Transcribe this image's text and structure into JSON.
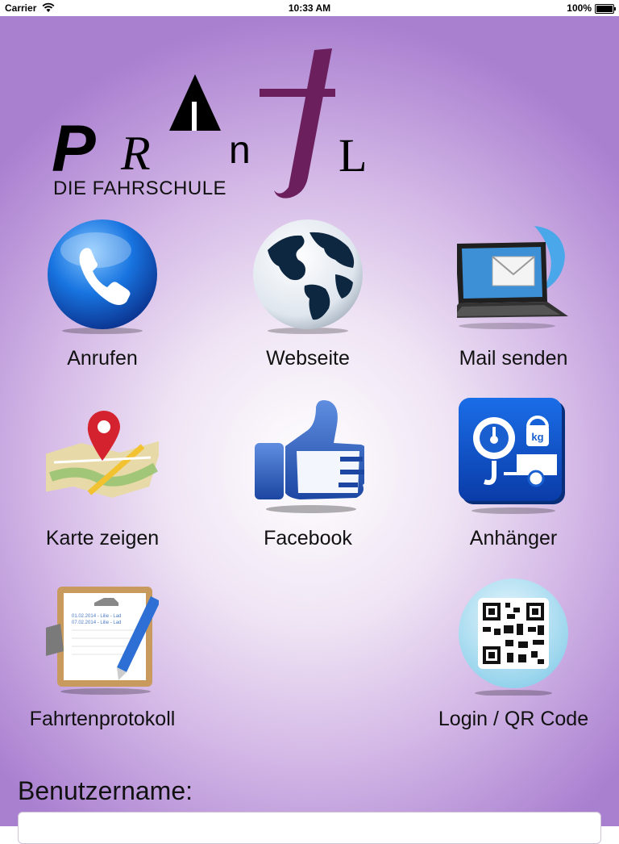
{
  "statusbar": {
    "carrier": "Carrier",
    "time": "10:33 AM",
    "battery": "100%"
  },
  "logo": {
    "letters": [
      "P",
      "R",
      "A",
      "n",
      "t",
      "L"
    ],
    "tagline": "DIE FAHRSCHULE",
    "accent_color": "#6b1f5c"
  },
  "tiles": [
    {
      "label": "Anrufen",
      "icon": "phone-icon"
    },
    {
      "label": "Webseite",
      "icon": "globe-icon"
    },
    {
      "label": "Mail senden",
      "icon": "laptop-mail-icon"
    },
    {
      "label": "Karte zeigen",
      "icon": "map-pin-icon"
    },
    {
      "label": "Facebook",
      "icon": "thumbs-up-icon"
    },
    {
      "label": "Anhänger",
      "icon": "trailer-scale-icon"
    },
    {
      "label": "Fahrtenprotokoll",
      "icon": "clipboard-pen-icon"
    },
    {
      "label": "Login / QR Code",
      "icon": "qr-code-icon"
    }
  ],
  "clipboard_lines": [
    "01.02.2014 - Lilie - Lad",
    "07.02.2014 - Lilie - Lad"
  ],
  "trailer_badge": "kg",
  "form": {
    "username_label": "Benutzername:",
    "username_value": "",
    "username_placeholder": ""
  },
  "colors": {
    "background_edge": "#a97fd0",
    "background_center": "#ffffff"
  }
}
